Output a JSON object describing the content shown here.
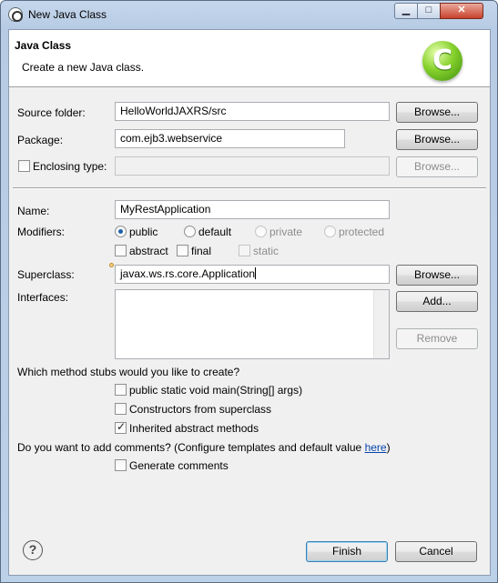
{
  "window": {
    "title": "New Java Class"
  },
  "banner": {
    "title": "Java Class",
    "description": "Create a new Java class.",
    "logo_glyph": "C"
  },
  "source_folder": {
    "label": "Source folder:",
    "value": "HelloWorldJAXRS/src",
    "browse_label": "Browse..."
  },
  "package": {
    "label": "Package:",
    "value": "com.ejb3.webservice",
    "browse_label": "Browse..."
  },
  "enclosing_type": {
    "label": "Enclosing type:",
    "value": "",
    "checked": false,
    "browse_label": "Browse..."
  },
  "name": {
    "label": "Name:",
    "value": "MyRestApplication"
  },
  "modifiers": {
    "label": "Modifiers:",
    "access": [
      {
        "label": "public",
        "checked": true,
        "enabled": true
      },
      {
        "label": "default",
        "checked": false,
        "enabled": true
      },
      {
        "label": "private",
        "checked": false,
        "enabled": false
      },
      {
        "label": "protected",
        "checked": false,
        "enabled": false
      }
    ],
    "flags": [
      {
        "label": "abstract",
        "checked": false,
        "enabled": true
      },
      {
        "label": "final",
        "checked": false,
        "enabled": true
      },
      {
        "label": "static",
        "checked": false,
        "enabled": false
      }
    ]
  },
  "superclass": {
    "label": "Superclass:",
    "value": "javax.ws.rs.core.Application",
    "browse_label": "Browse..."
  },
  "interfaces": {
    "label": "Interfaces:",
    "add_label": "Add...",
    "remove_label": "Remove"
  },
  "stubs": {
    "question": "Which method stubs would you like to create?",
    "options": [
      {
        "label": "public static void main(String[] args)",
        "checked": false
      },
      {
        "label": "Constructors from superclass",
        "checked": false
      },
      {
        "label": "Inherited abstract methods",
        "checked": true
      }
    ]
  },
  "comments": {
    "question_prefix": "Do you want to add comments? (Configure templates and default value ",
    "link": "here",
    "question_suffix": ")",
    "generate_label": "Generate comments",
    "checked": false
  },
  "footer": {
    "finish_label": "Finish",
    "cancel_label": "Cancel"
  }
}
